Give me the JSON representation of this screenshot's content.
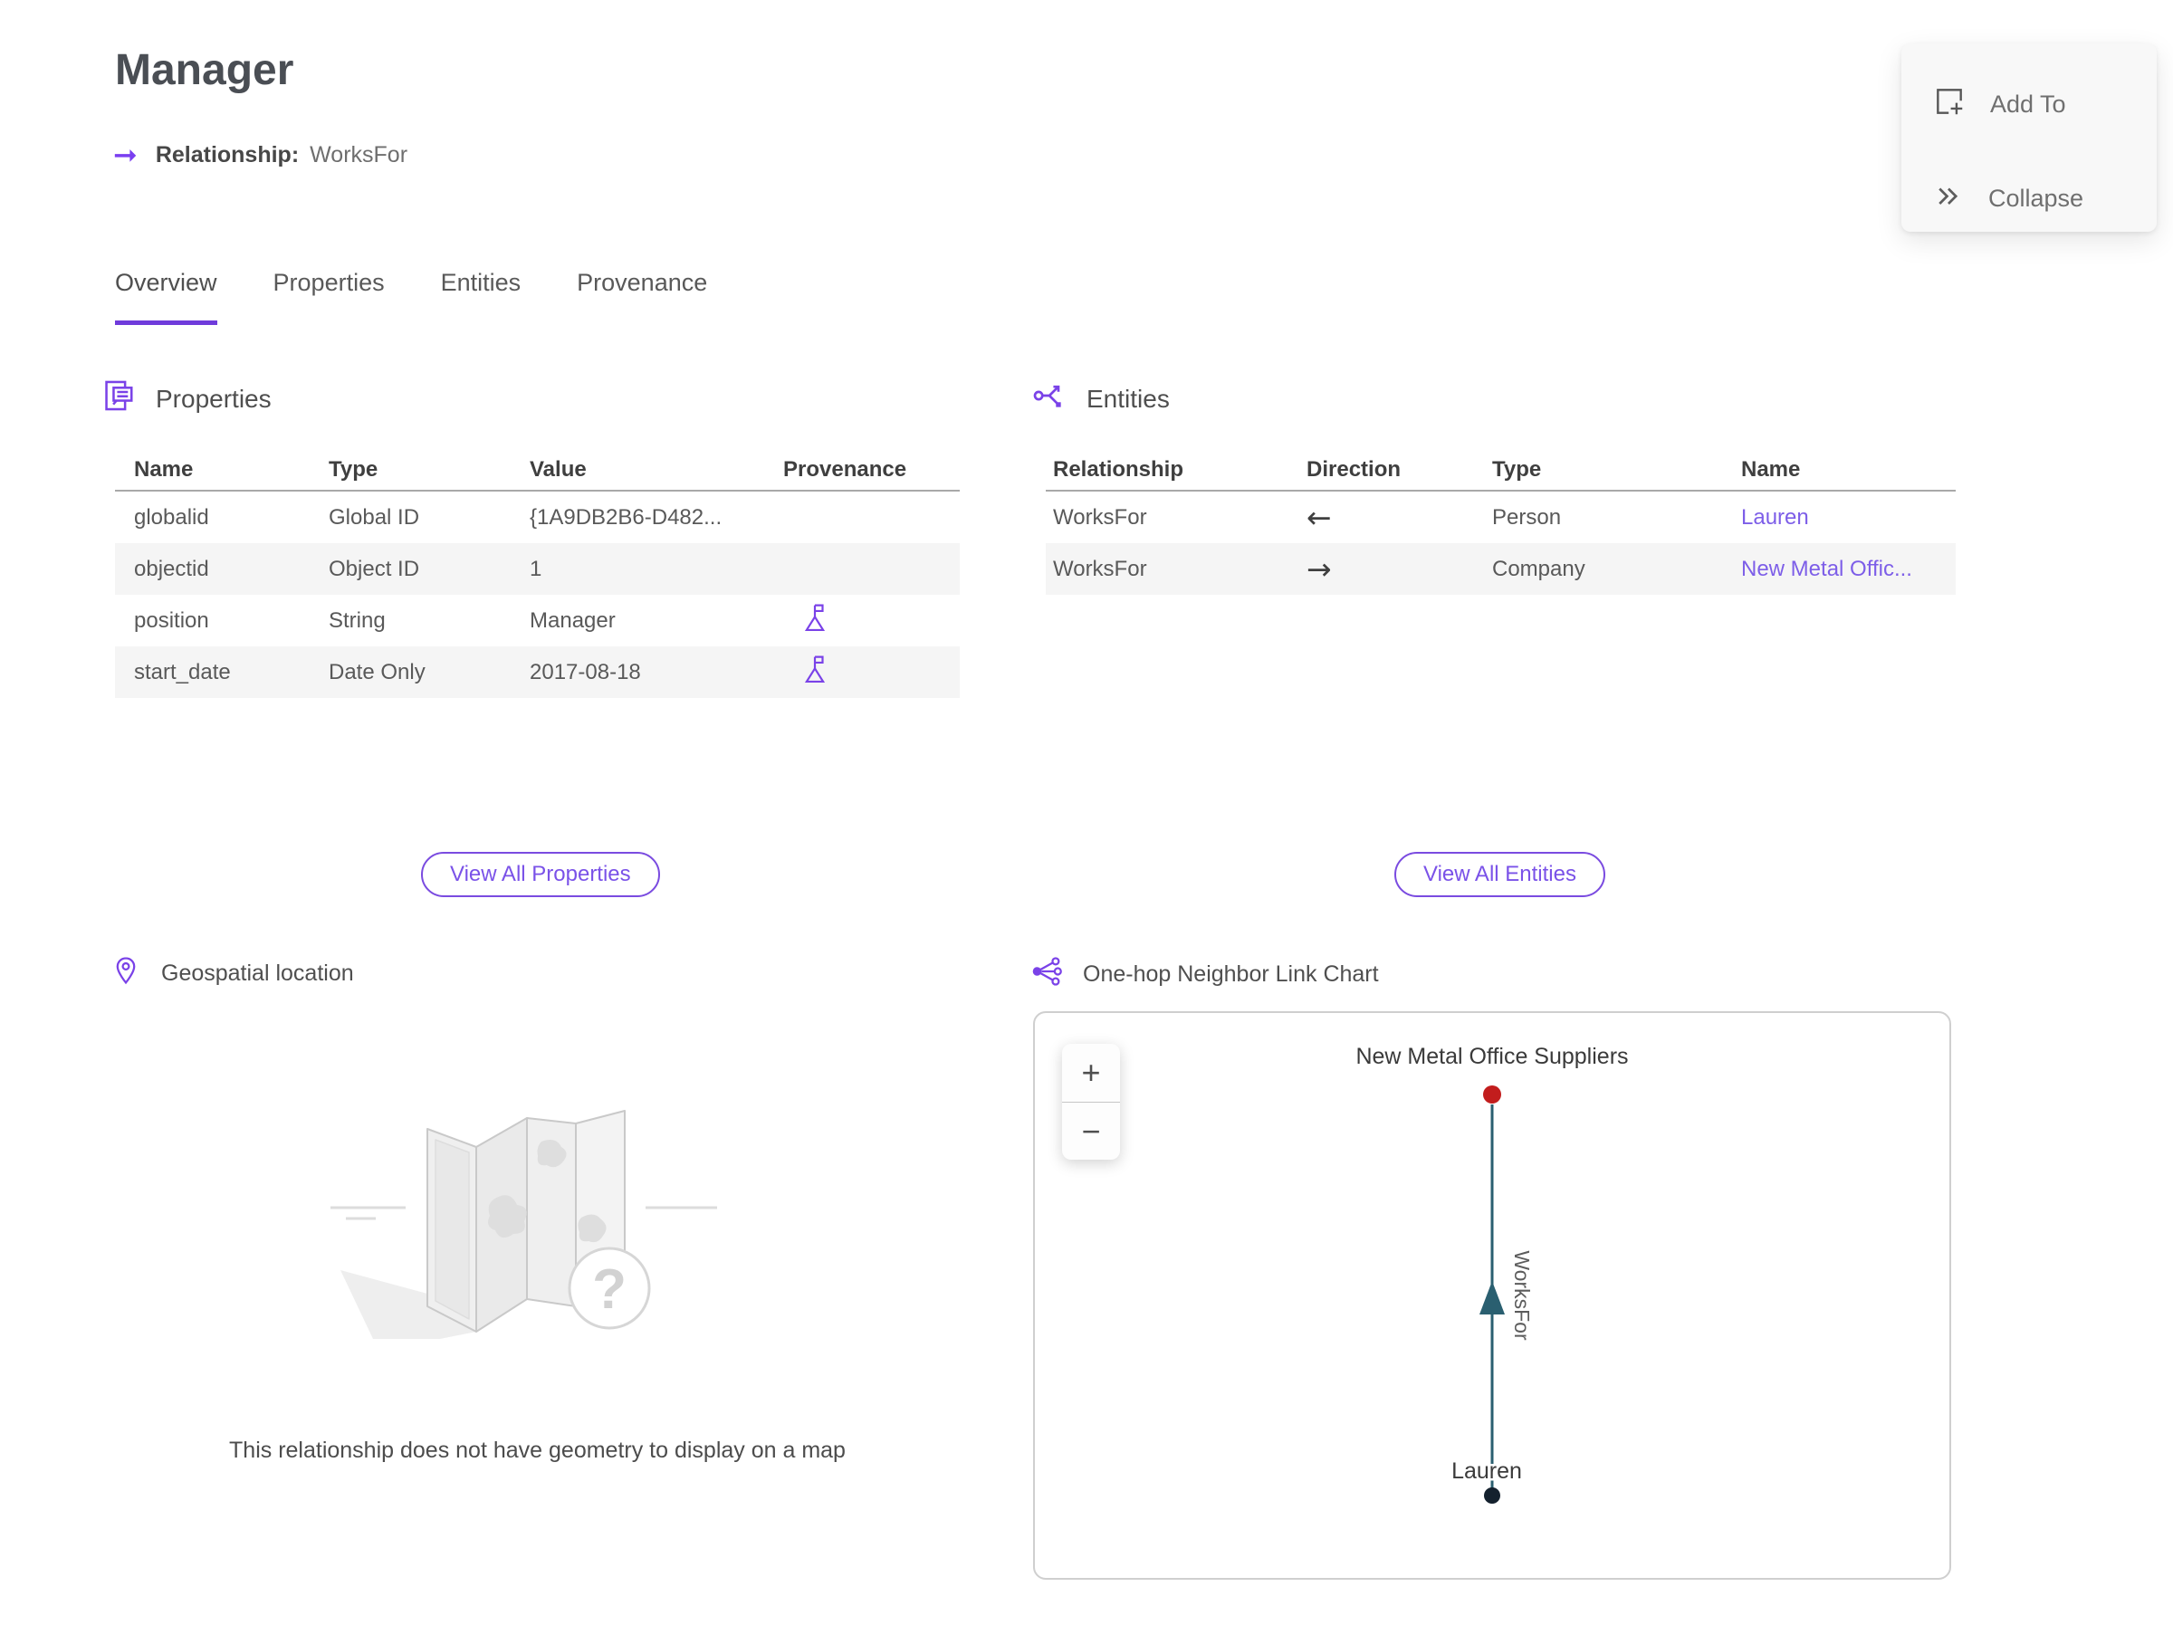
{
  "header": {
    "title": "Manager",
    "relationship_label": "Relationship:",
    "relationship_value": "WorksFor"
  },
  "actions": {
    "add_to_label": "Add To",
    "collapse_label": "Collapse"
  },
  "tabs": [
    {
      "label": "Overview",
      "active": true
    },
    {
      "label": "Properties",
      "active": false
    },
    {
      "label": "Entities",
      "active": false
    },
    {
      "label": "Provenance",
      "active": false
    }
  ],
  "properties": {
    "section_title": "Properties",
    "columns": [
      "Name",
      "Type",
      "Value",
      "Provenance"
    ],
    "rows": [
      {
        "name": "globalid",
        "type": "Global ID",
        "value": "{1A9DB2B6-D482...",
        "has_provenance": false
      },
      {
        "name": "objectid",
        "type": "Object ID",
        "value": "1",
        "has_provenance": false
      },
      {
        "name": "position",
        "type": "String",
        "value": "Manager",
        "has_provenance": true
      },
      {
        "name": "start_date",
        "type": "Date Only",
        "value": "2017-08-18",
        "has_provenance": true
      }
    ],
    "view_all_label": "View All Properties"
  },
  "entities": {
    "section_title": "Entities",
    "columns": [
      "Relationship",
      "Direction",
      "Type",
      "Name"
    ],
    "rows": [
      {
        "relationship": "WorksFor",
        "direction": "←",
        "type": "Person",
        "name": "Lauren"
      },
      {
        "relationship": "WorksFor",
        "direction": "→",
        "type": "Company",
        "name": "New Metal Offic..."
      }
    ],
    "view_all_label": "View All Entities"
  },
  "geospatial": {
    "section_title": "Geospatial location",
    "empty_message": "This relationship does not have geometry to display on a map"
  },
  "link_chart": {
    "section_title": "One-hop Neighbor Link Chart",
    "zoom_in_label": "+",
    "zoom_out_label": "−",
    "top_node_label": "New Metal Office Suppliers",
    "bottom_node_label": "Lauren",
    "edge_label": "WorksFor",
    "top_node_color": "#c21d1d",
    "bottom_node_color": "#14212e",
    "edge_color": "#2a5f70"
  },
  "colors": {
    "accent_purple": "#7a42e8",
    "link_purple": "#7d5ee8",
    "tab_underline": "#6f3bdb",
    "row_alt_bg": "#f5f5f5"
  }
}
